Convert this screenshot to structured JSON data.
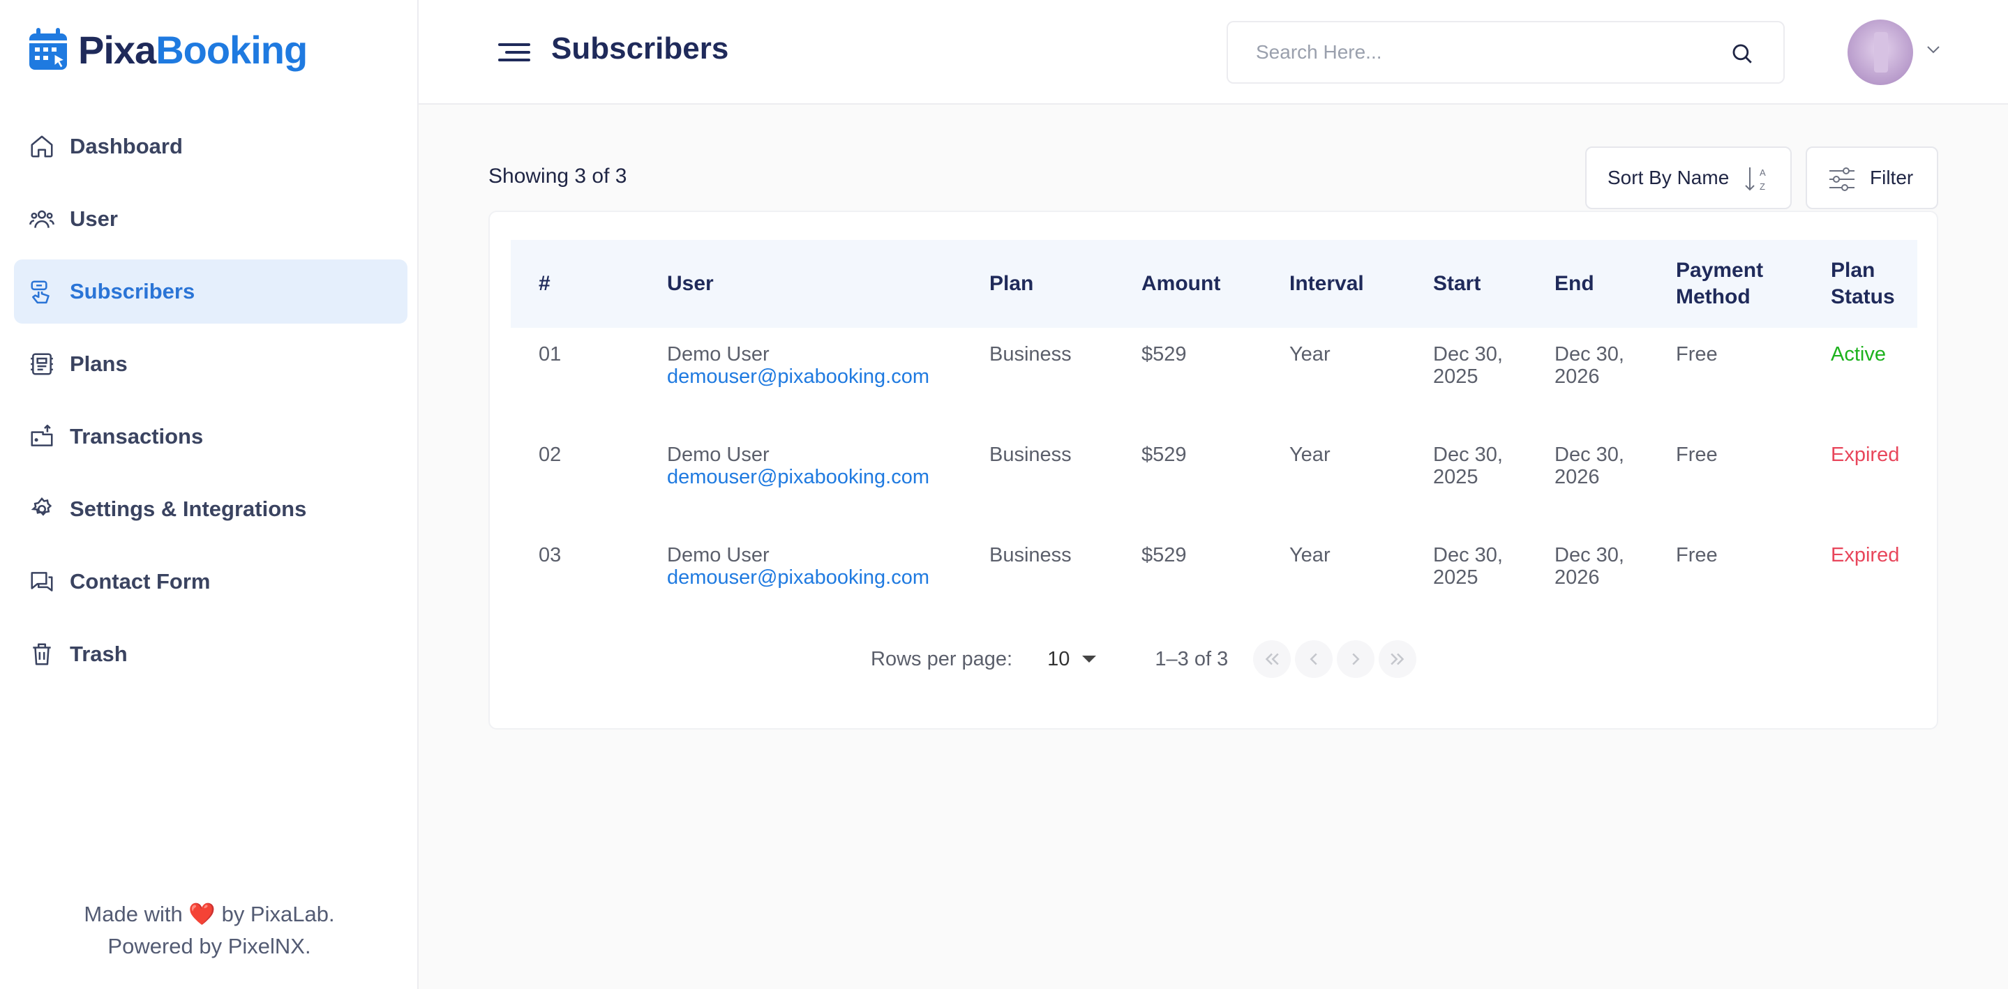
{
  "brand": {
    "name_part1": "Pixa",
    "name_part2": "Booking"
  },
  "header": {
    "title": "Subscribers",
    "search_placeholder": "Search Here..."
  },
  "sidebar": {
    "items": [
      {
        "label": "Dashboard",
        "icon": "home-icon"
      },
      {
        "label": "User",
        "icon": "users-icon"
      },
      {
        "label": "Subscribers",
        "icon": "subscribers-icon",
        "active": true
      },
      {
        "label": "Plans",
        "icon": "plans-icon"
      },
      {
        "label": "Transactions",
        "icon": "transactions-icon"
      },
      {
        "label": "Settings & Integrations",
        "icon": "gear-icon"
      },
      {
        "label": "Contact Form",
        "icon": "chat-icon"
      },
      {
        "label": "Trash",
        "icon": "trash-icon"
      }
    ],
    "footer_line1_pre": "Made with",
    "footer_heart": "❤️",
    "footer_line1_post": "by PixaLab.",
    "footer_line2": "Powered by PixelNX."
  },
  "toolbar": {
    "count_text": "Showing 3 of 3",
    "sort_label": "Sort By Name",
    "filter_label": "Filter"
  },
  "table": {
    "headers": [
      "#",
      "User",
      "Plan",
      "Amount",
      "Interval",
      "Start",
      "End",
      "Payment Method",
      "Plan Status"
    ],
    "rows": [
      {
        "num": "01",
        "name": "Demo User",
        "email": "demouser@pixabooking.com",
        "plan": "Business",
        "amount": "$529",
        "interval": "Year",
        "start": "Dec 30, 2025",
        "end": "Dec 30, 2026",
        "payment": "Free",
        "status": "Active"
      },
      {
        "num": "02",
        "name": "Demo User",
        "email": "demouser@pixabooking.com",
        "plan": "Business",
        "amount": "$529",
        "interval": "Year",
        "start": "Dec 30, 2025",
        "end": "Dec 30, 2026",
        "payment": "Free",
        "status": "Expired"
      },
      {
        "num": "03",
        "name": "Demo User",
        "email": "demouser@pixabooking.com",
        "plan": "Business",
        "amount": "$529",
        "interval": "Year",
        "start": "Dec 30, 2025",
        "end": "Dec 30, 2026",
        "payment": "Free",
        "status": "Expired"
      }
    ]
  },
  "pagination": {
    "rows_per_page_label": "Rows per page:",
    "rows_per_page_value": "10",
    "range_text": "1–3 of 3"
  },
  "colors": {
    "accent": "#1f7ae0",
    "active_nav_bg": "#e5effc",
    "status_active": "#1db21d",
    "status_expired": "#e8465b"
  }
}
